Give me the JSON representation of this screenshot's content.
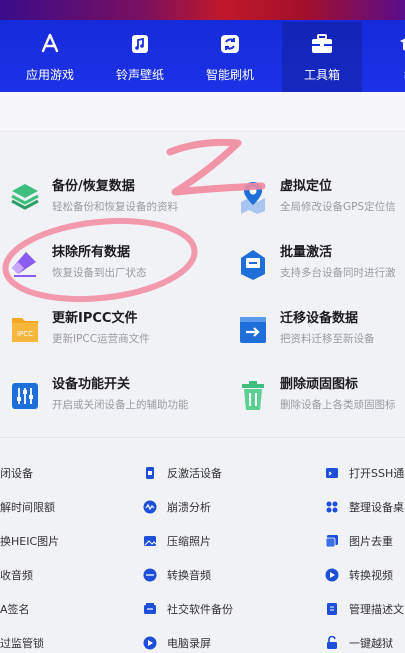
{
  "colors": {
    "nav_bg": "#1a2fe0",
    "annotation": "#f28aa0",
    "icon_blue": "#1e6fd9"
  },
  "nav": {
    "items": [
      {
        "label": "应用游戏",
        "icon": "app-store-icon"
      },
      {
        "label": "铃声壁纸",
        "icon": "music-note-icon"
      },
      {
        "label": "智能刷机",
        "icon": "refresh-icon"
      },
      {
        "label": "工具箱",
        "icon": "toolbox-icon",
        "active": true
      },
      {
        "label": "教",
        "icon": "graduation-icon"
      }
    ]
  },
  "cards": [
    {
      "title": "备份/恢复数据",
      "desc": "轻松备份和恢复设备的资料",
      "icon": "layers-icon"
    },
    {
      "title": "虚拟定位",
      "desc": "全局修改设备GPS定位信",
      "icon": "location-pin-icon"
    },
    {
      "title": "抹除所有数据",
      "desc": "恢复设备到出厂状态",
      "icon": "eraser-icon"
    },
    {
      "title": "批量激活",
      "desc": "支持多台设备同时进行激",
      "icon": "batch-activate-icon"
    },
    {
      "title": "更新IPCC文件",
      "desc": "更新IPCC运营商文件",
      "icon": "ipcc-folder-icon",
      "icon_text": "IPCC"
    },
    {
      "title": "迁移设备数据",
      "desc": "把资料迁移至新设备",
      "icon": "migrate-icon"
    },
    {
      "title": "设备功能开关",
      "desc": "开启或关闭设备上的辅助功能",
      "icon": "toggle-sliders-icon"
    },
    {
      "title": "删除顽固图标",
      "desc": "删除设备上各类顽固图标",
      "icon": "trash-icon"
    }
  ],
  "tools": [
    {
      "label": "闭设备",
      "icon": "power-icon"
    },
    {
      "label": "反激活设备",
      "icon": "phone-lock-icon"
    },
    {
      "label": "打开SSH通",
      "icon": "terminal-icon"
    },
    {
      "label": "解时间限额",
      "icon": "clock-icon"
    },
    {
      "label": "崩溃分析",
      "icon": "wave-icon"
    },
    {
      "label": "整理设备桌",
      "icon": "grid-icon"
    },
    {
      "label": "换HEIC图片",
      "icon": "image-convert-icon"
    },
    {
      "label": "压缩照片",
      "icon": "photo-icon"
    },
    {
      "label": "图片去重",
      "icon": "image-dedupe-icon"
    },
    {
      "label": "收音频",
      "icon": "audio-icon"
    },
    {
      "label": "转换音频",
      "icon": "audio-convert-icon"
    },
    {
      "label": "转换视频",
      "icon": "video-convert-icon"
    },
    {
      "label": "A签名",
      "icon": "signature-icon"
    },
    {
      "label": "社交软件备份",
      "icon": "social-backup-icon"
    },
    {
      "label": "管理描述文",
      "icon": "profile-icon"
    },
    {
      "label": "过监管锁",
      "icon": "unlock-icon"
    },
    {
      "label": "电脑录屏",
      "icon": "record-icon"
    },
    {
      "label": "一键越狱",
      "icon": "jailbreak-icon"
    }
  ]
}
